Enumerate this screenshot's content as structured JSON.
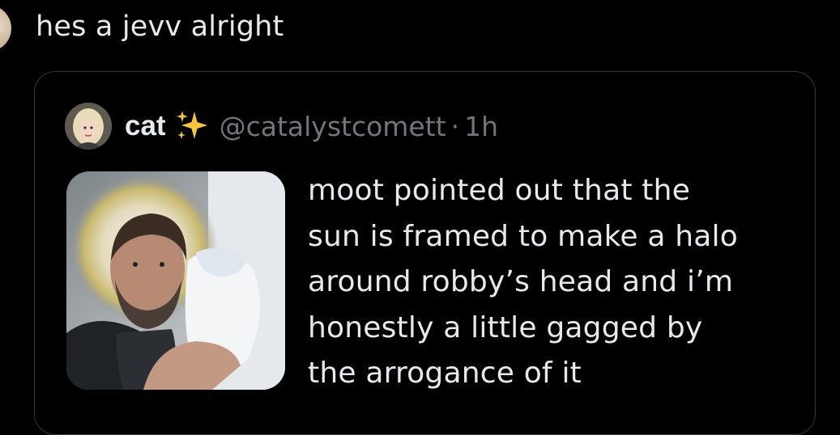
{
  "post": {
    "text": "hes a jevv alright"
  },
  "quoted_post": {
    "display_name": "cat",
    "name_emoji": "sparkles-icon",
    "handle": "@catalystcomett",
    "separator": "·",
    "timestamp": "1h",
    "text": "moot pointed out that the\nsun is framed to make a halo\naround robby’s head and i’m\nhonestly a little gagged by\nthe arrogance of it"
  },
  "colors": {
    "background": "#000000",
    "primary_text": "#e7e9ea",
    "secondary_text": "#71767b",
    "card_border": "#333639",
    "sparkle": "#f5c542"
  }
}
